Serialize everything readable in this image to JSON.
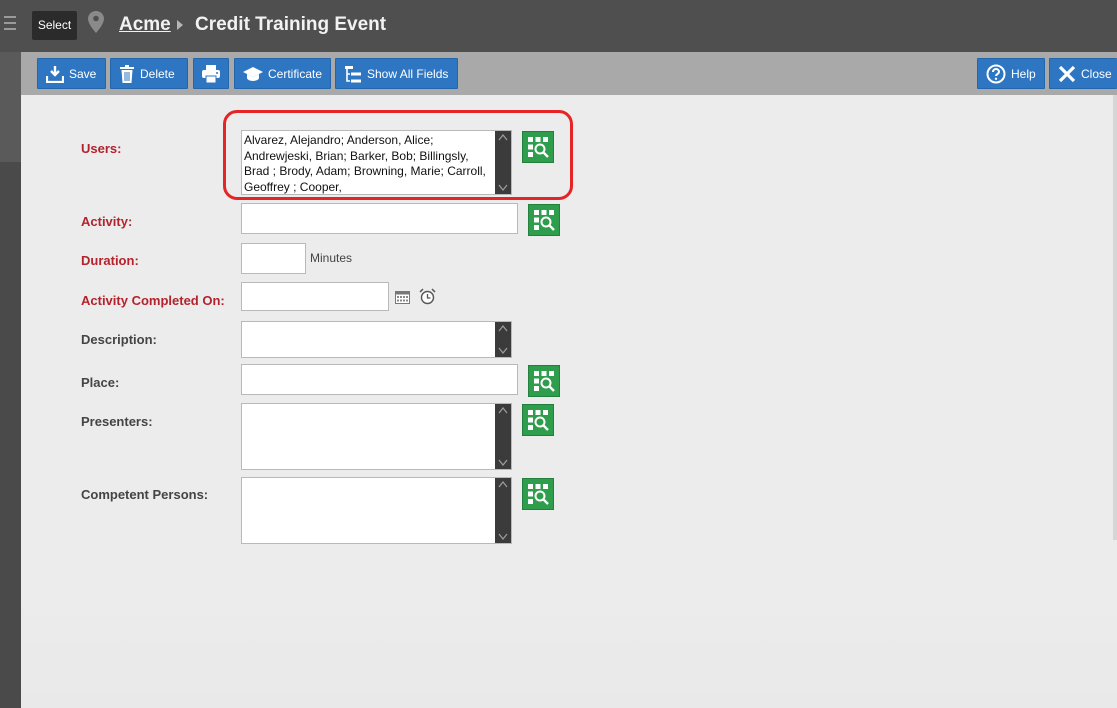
{
  "header": {
    "select_label": "Select",
    "breadcrumb_link": "Acme",
    "page_title": "Credit Training Event"
  },
  "toolbar": {
    "save_label": "Save",
    "delete_label": "Delete",
    "certificate_label": "Certificate",
    "show_all_fields_label": "Show All Fields",
    "help_label": "Help",
    "close_label": "Close",
    "accent_color": "#2f76c2"
  },
  "form": {
    "users_label": "Users:",
    "users_value": "Alvarez, Alejandro; Anderson, Alice; Andrewjeski, Brian; Barker, Bob; Billingsly, Brad ; Brody, Adam; Browning, Marie; Carroll, Geoffrey ; Cooper,",
    "activity_label": "Activity:",
    "activity_value": "",
    "duration_label": "Duration:",
    "duration_value": "",
    "duration_unit": "Minutes",
    "completed_on_label": "Activity Completed On:",
    "completed_on_value": "",
    "description_label": "Description:",
    "description_value": "",
    "place_label": "Place:",
    "place_value": "",
    "presenters_label": "Presenters:",
    "presenters_value": "",
    "competent_persons_label": "Competent Persons:",
    "competent_persons_value": "",
    "required_color": "#b3232d",
    "lookup_color": "#2e9d4c"
  },
  "annotation": {
    "highlight_color": "#e52525"
  }
}
